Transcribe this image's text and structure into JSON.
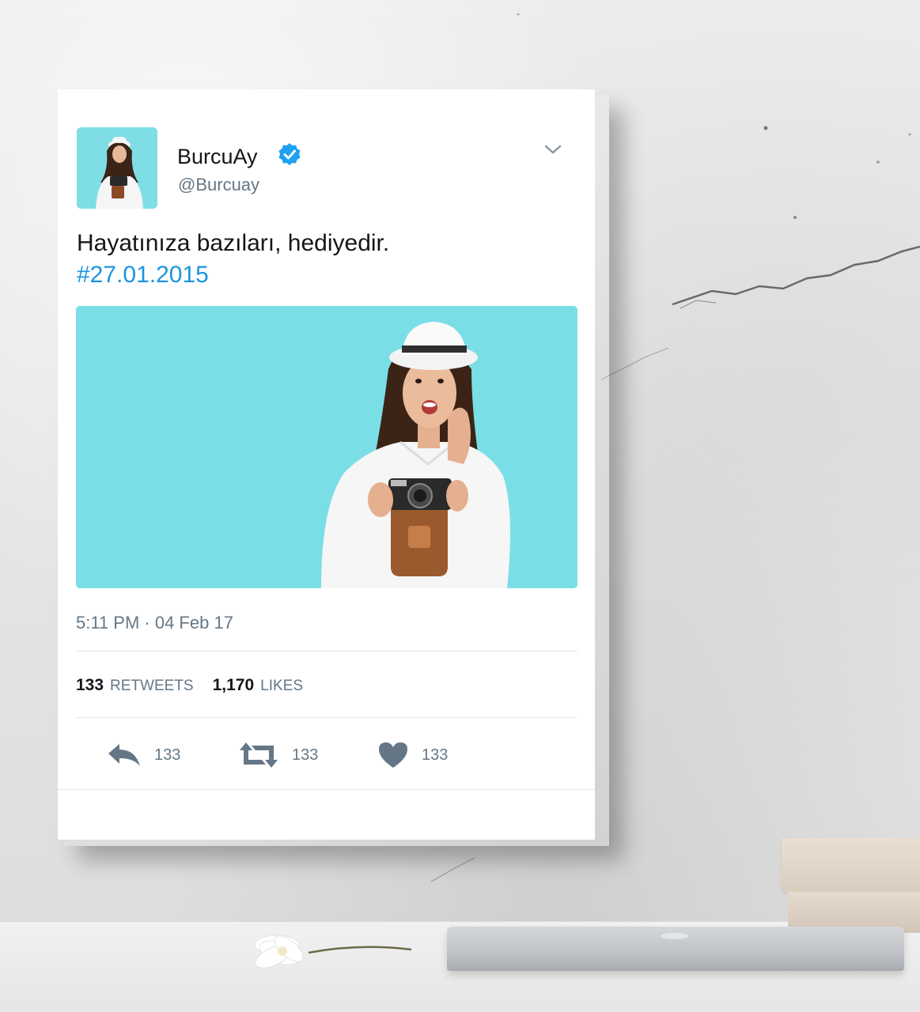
{
  "tweet": {
    "display_name": "BurcuAy",
    "handle": "@Burcuay",
    "text": "Hayatınıza bazıları, hediyedir.",
    "hashtag": "#27.01.2015",
    "timestamp": "5:11 PM · 04 Feb 17",
    "stats": {
      "retweets_count": "133",
      "retweets_label": "RETWEETS",
      "likes_count": "1,170",
      "likes_label": "LIKES"
    },
    "actions": {
      "reply_count": "133",
      "retweet_count": "133",
      "like_count": "133"
    }
  },
  "icons": {
    "verified": "verified-badge-icon",
    "menu": "chevron-down-icon",
    "reply": "reply-icon",
    "retweet": "retweet-icon",
    "like": "heart-icon"
  },
  "colors": {
    "verified_blue": "#1da1f2",
    "hashtag_blue": "#1b95e0",
    "action_gray": "#657786",
    "media_background": "#7adee6"
  }
}
